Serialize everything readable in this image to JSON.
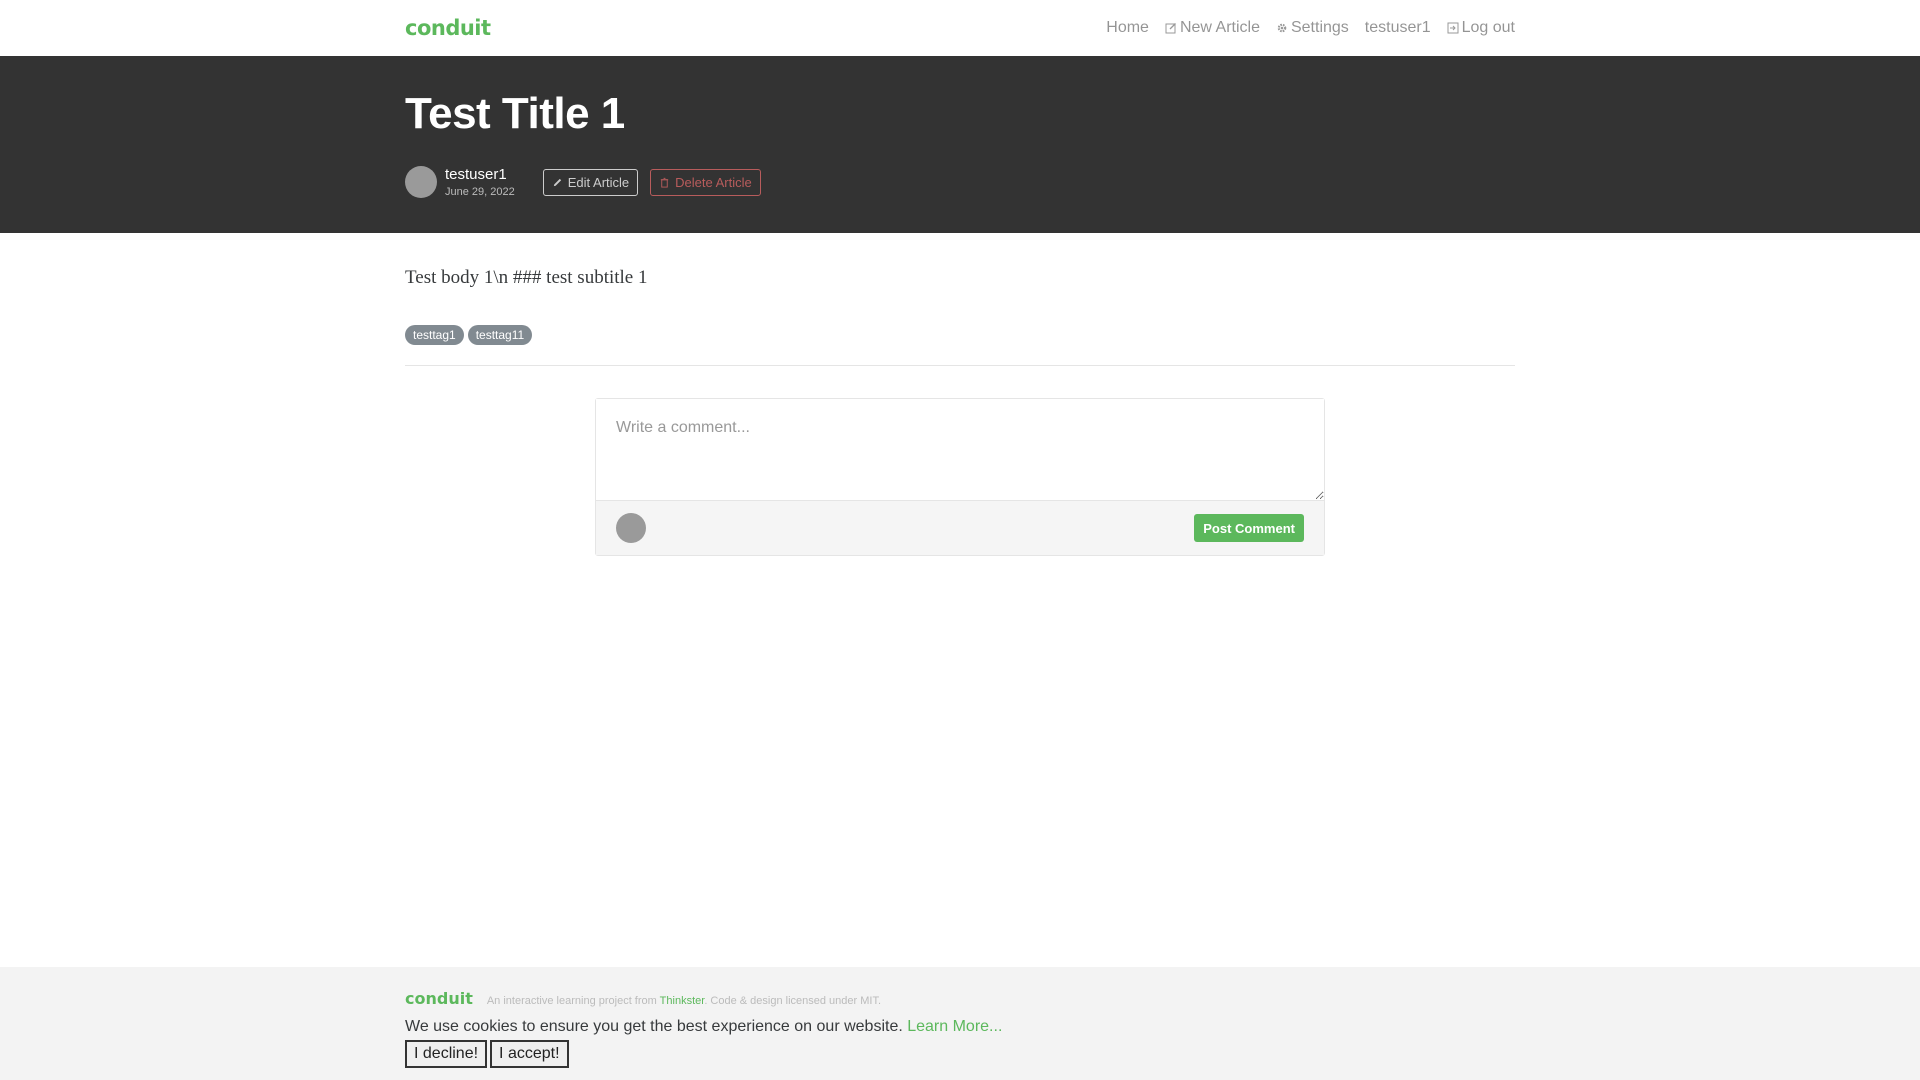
{
  "navbar": {
    "brand": "conduit",
    "items": [
      {
        "label": "Home",
        "icon": ""
      },
      {
        "label": "New Article",
        "icon": "edit-icon"
      },
      {
        "label": "Settings",
        "icon": "gear-icon"
      },
      {
        "label": "testuser1",
        "icon": ""
      },
      {
        "label": "Log out",
        "icon": "logout-icon"
      }
    ]
  },
  "article": {
    "title": "Test Title 1",
    "author": "testuser1",
    "date": "June 29, 2022",
    "edit_label": "Edit Article",
    "delete_label": "Delete Article",
    "body": "Test body 1\\n ### test subtitle 1",
    "tags": [
      "testtag1",
      "testtag11"
    ]
  },
  "comment_form": {
    "placeholder": "Write a comment...",
    "post_label": "Post Comment"
  },
  "footer": {
    "logo": "conduit",
    "attribution_prefix": "An interactive learning project from ",
    "attribution_link": "Thinkster",
    "attribution_suffix": ". Code & design licensed under MIT."
  },
  "cookie_banner": {
    "text": "We use cookies to ensure you get the best experience on our website. ",
    "learn_more": "Learn More...",
    "decline_label": "I decline!",
    "accept_label": "I accept!"
  },
  "colors": {
    "brand": "#5cb85c",
    "banner": "#333333",
    "danger": "#b85c5c"
  }
}
